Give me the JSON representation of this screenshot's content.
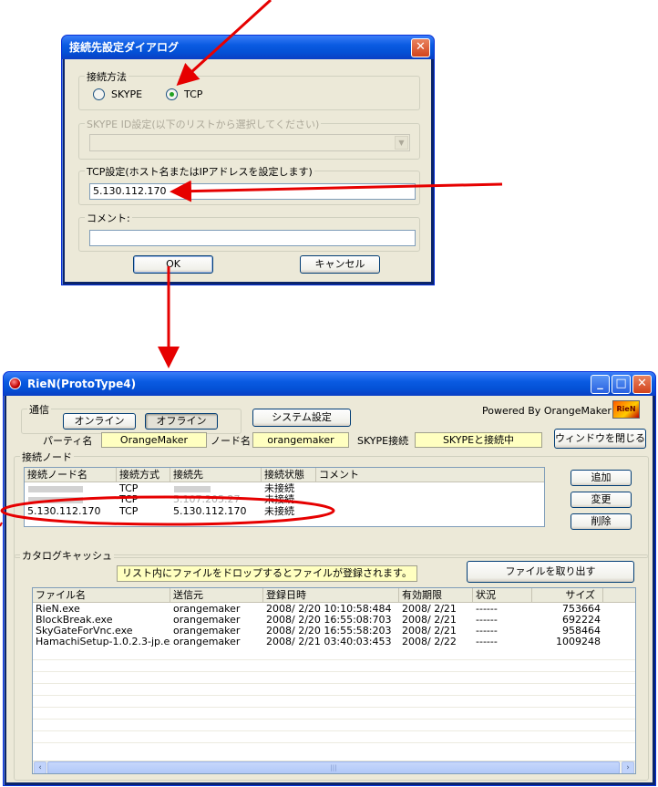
{
  "dialog": {
    "title": "接続先設定ダイアログ",
    "method_group": "接続方法",
    "radio_skype": "SKYPE",
    "radio_tcp": "TCP",
    "skype_group": "SKYPE ID設定(以下のリストから選択してください)",
    "tcp_group": "TCP設定(ホスト名またはIPアドレスを設定します)",
    "tcp_value": "5.130.112.170",
    "comment_group": "コメント:",
    "comment_value": "",
    "ok_label": "OK",
    "cancel_label": "キャンセル",
    "close_glyph": "✕"
  },
  "main": {
    "title": "RieN(ProtoType4)",
    "powered_by": "Powered By OrangeMaker",
    "logo_text": "RieN",
    "comm_group": "通信",
    "online_label": "オンライン",
    "offline_label": "オフライン",
    "system_settings_label": "システム設定",
    "party_label": "パーティ名",
    "party_value": "OrangeMaker",
    "node_label": "ノード名",
    "node_value": "orangemaker",
    "skype_conn_label": "SKYPE接続",
    "skype_conn_value": "SKYPEと接続中",
    "close_window_label": "ウィンドウを閉じる",
    "nodes_group": "接続ノード",
    "add_label": "追加",
    "change_label": "変更",
    "delete_label": "削除",
    "node_columns": [
      "接続ノード名",
      "接続方式",
      "接続先",
      "接続状態",
      "コメント"
    ],
    "node_rows": [
      {
        "name": "",
        "method": "TCP",
        "target": "",
        "status": "未接続",
        "comment": ""
      },
      {
        "name": "",
        "method": "TCP",
        "target": "5.107.205.27",
        "status": "未接続",
        "comment": ""
      },
      {
        "name": "5.130.112.170",
        "method": "TCP",
        "target": "5.130.112.170",
        "status": "未接続",
        "comment": ""
      }
    ],
    "catalog_group": "カタログキャッシュ",
    "catalog_hint": "リスト内にファイルをドロップするとファイルが登録されます。",
    "extract_label": "ファイルを取り出す",
    "file_columns": [
      "ファイル名",
      "送信元",
      "登録日時",
      "有効期限",
      "状況",
      "サイズ"
    ],
    "file_rows": [
      {
        "name": "RieN.exe",
        "sender": "orangemaker",
        "date": "2008/ 2/20 10:10:58:484",
        "expiry": "2008/ 2/21",
        "status": "------",
        "size": "753664"
      },
      {
        "name": "BlockBreak.exe",
        "sender": "orangemaker",
        "date": "2008/ 2/20 16:55:08:703",
        "expiry": "2008/ 2/21",
        "status": "------",
        "size": "692224"
      },
      {
        "name": "SkyGateForVnc.exe",
        "sender": "orangemaker",
        "date": "2008/ 2/20 16:55:58:203",
        "expiry": "2008/ 2/21",
        "status": "------",
        "size": "958464"
      },
      {
        "name": "HamachiSetup-1.0.2.3-jp.exe",
        "sender": "orangemaker",
        "date": "2008/ 2/21 03:40:03:453",
        "expiry": "2008/ 2/22",
        "status": "------",
        "size": "1009248"
      }
    ],
    "minimize_glyph": "_",
    "maximize_glyph": "□",
    "close_glyph": "✕",
    "scroll_left": "‹",
    "scroll_right": "›",
    "scroll_grip": "|||"
  },
  "colors": {
    "annotation": "#e60000",
    "xp_title": "#0a5be2",
    "yellow_field": "#ffffc0"
  }
}
